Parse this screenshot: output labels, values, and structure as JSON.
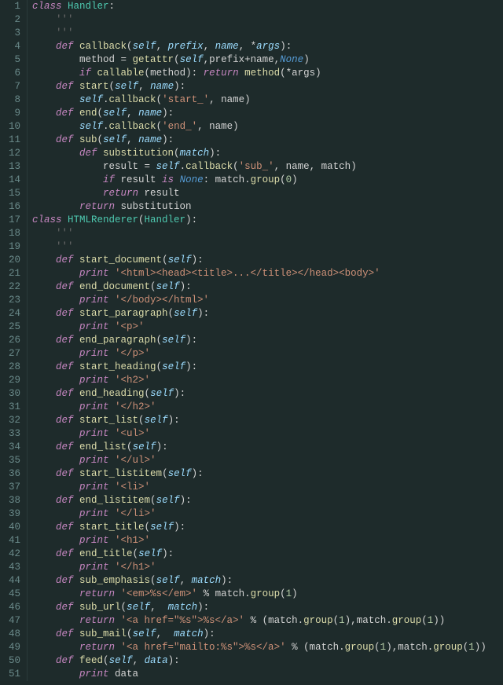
{
  "file_type": "python",
  "line_count": 51,
  "lines": {
    "l1": {
      "indent": "",
      "tokens": [
        [
          "kw",
          "class "
        ],
        [
          "cls",
          "Handler"
        ],
        [
          "punct",
          ":"
        ]
      ]
    },
    "l2": {
      "indent": "    ",
      "tokens": [
        [
          "cmt",
          "'''"
        ]
      ]
    },
    "l3": {
      "indent": "    ",
      "tokens": [
        [
          "cmt",
          "'''"
        ]
      ]
    },
    "l4": {
      "indent": "    ",
      "tokens": [
        [
          "kw",
          "def "
        ],
        [
          "fn",
          "callback"
        ],
        [
          "punct",
          "("
        ],
        [
          "self",
          "self"
        ],
        [
          "punct",
          ", "
        ],
        [
          "param",
          "prefix"
        ],
        [
          "punct",
          ", "
        ],
        [
          "param",
          "name"
        ],
        [
          "punct",
          ", "
        ],
        [
          "op",
          "*"
        ],
        [
          "param",
          "args"
        ],
        [
          "punct",
          "):"
        ]
      ]
    },
    "l5": {
      "indent": "        ",
      "tokens": [
        [
          "op",
          "method "
        ],
        [
          "op",
          "= "
        ],
        [
          "getattr",
          "getattr"
        ],
        [
          "punct",
          "("
        ],
        [
          "self",
          "self"
        ],
        [
          "punct",
          ","
        ],
        [
          "op",
          "prefix"
        ],
        [
          "op",
          "+"
        ],
        [
          "op",
          "name"
        ],
        [
          "punct",
          ","
        ],
        [
          "none",
          "None"
        ],
        [
          "punct",
          ")"
        ]
      ]
    },
    "l6": {
      "indent": "        ",
      "tokens": [
        [
          "kw",
          "if "
        ],
        [
          "builtin",
          "callable"
        ],
        [
          "punct",
          "("
        ],
        [
          "op",
          "method"
        ],
        [
          "punct",
          "): "
        ],
        [
          "kw",
          "return "
        ],
        [
          "fn",
          "method"
        ],
        [
          "punct",
          "("
        ],
        [
          "op",
          "*"
        ],
        [
          "op",
          "args"
        ],
        [
          "punct",
          ")"
        ]
      ]
    },
    "l7": {
      "indent": "    ",
      "tokens": [
        [
          "kw",
          "def "
        ],
        [
          "fn",
          "start"
        ],
        [
          "punct",
          "("
        ],
        [
          "self",
          "self"
        ],
        [
          "punct",
          ", "
        ],
        [
          "param",
          "name"
        ],
        [
          "punct",
          "):"
        ]
      ]
    },
    "l8": {
      "indent": "        ",
      "tokens": [
        [
          "self",
          "self"
        ],
        [
          "punct",
          "."
        ],
        [
          "fn",
          "callback"
        ],
        [
          "punct",
          "("
        ],
        [
          "str",
          "'start_'"
        ],
        [
          "punct",
          ", "
        ],
        [
          "op",
          "name"
        ],
        [
          "punct",
          ")"
        ]
      ]
    },
    "l9": {
      "indent": "    ",
      "tokens": [
        [
          "kw",
          "def "
        ],
        [
          "fn",
          "end"
        ],
        [
          "punct",
          "("
        ],
        [
          "self",
          "self"
        ],
        [
          "punct",
          ", "
        ],
        [
          "param",
          "name"
        ],
        [
          "punct",
          "):"
        ]
      ]
    },
    "l10": {
      "indent": "        ",
      "tokens": [
        [
          "self",
          "self"
        ],
        [
          "punct",
          "."
        ],
        [
          "fn",
          "callback"
        ],
        [
          "punct",
          "("
        ],
        [
          "str",
          "'end_'"
        ],
        [
          "punct",
          ", "
        ],
        [
          "op",
          "name"
        ],
        [
          "punct",
          ")"
        ]
      ]
    },
    "l11": {
      "indent": "    ",
      "tokens": [
        [
          "kw",
          "def "
        ],
        [
          "fn",
          "sub"
        ],
        [
          "punct",
          "("
        ],
        [
          "self",
          "self"
        ],
        [
          "punct",
          ", "
        ],
        [
          "param",
          "name"
        ],
        [
          "punct",
          "):"
        ]
      ]
    },
    "l12": {
      "indent": "        ",
      "tokens": [
        [
          "kw",
          "def "
        ],
        [
          "fn",
          "substitution"
        ],
        [
          "punct",
          "("
        ],
        [
          "param",
          "match"
        ],
        [
          "punct",
          "):"
        ]
      ]
    },
    "l13": {
      "indent": "            ",
      "tokens": [
        [
          "op",
          "result "
        ],
        [
          "op",
          "= "
        ],
        [
          "self",
          "self"
        ],
        [
          "punct",
          "."
        ],
        [
          "fn",
          "callback"
        ],
        [
          "punct",
          "("
        ],
        [
          "str",
          "'sub_'"
        ],
        [
          "punct",
          ", "
        ],
        [
          "op",
          "name"
        ],
        [
          "punct",
          ", "
        ],
        [
          "op",
          "match"
        ],
        [
          "punct",
          ")"
        ]
      ]
    },
    "l14": {
      "indent": "            ",
      "tokens": [
        [
          "kw",
          "if "
        ],
        [
          "op",
          "result "
        ],
        [
          "kw",
          "is "
        ],
        [
          "none",
          "None"
        ],
        [
          "punct",
          ": "
        ],
        [
          "op",
          "match"
        ],
        [
          "punct",
          "."
        ],
        [
          "fn",
          "group"
        ],
        [
          "punct",
          "("
        ],
        [
          "num",
          "0"
        ],
        [
          "punct",
          ")"
        ]
      ]
    },
    "l15": {
      "indent": "            ",
      "tokens": [
        [
          "kw",
          "return "
        ],
        [
          "op",
          "result"
        ]
      ]
    },
    "l16": {
      "indent": "        ",
      "tokens": [
        [
          "kw",
          "return "
        ],
        [
          "op",
          "substitution"
        ]
      ]
    },
    "l17": {
      "indent": "",
      "tokens": [
        [
          "kw",
          "class "
        ],
        [
          "cls",
          "HTMLRenderer"
        ],
        [
          "punct",
          "("
        ],
        [
          "cls",
          "Handler"
        ],
        [
          "punct",
          "):"
        ]
      ]
    },
    "l18": {
      "indent": "    ",
      "tokens": [
        [
          "cmt",
          "'''"
        ]
      ]
    },
    "l19": {
      "indent": "    ",
      "tokens": [
        [
          "cmt",
          "'''"
        ]
      ]
    },
    "l20": {
      "indent": "    ",
      "tokens": [
        [
          "kw",
          "def "
        ],
        [
          "fn",
          "start_document"
        ],
        [
          "punct",
          "("
        ],
        [
          "self",
          "self"
        ],
        [
          "punct",
          "):"
        ]
      ]
    },
    "l21": {
      "indent": "        ",
      "tokens": [
        [
          "kw",
          "print "
        ],
        [
          "str",
          "'<html><head><title>...</title></head><body>'"
        ]
      ]
    },
    "l22": {
      "indent": "    ",
      "tokens": [
        [
          "kw",
          "def "
        ],
        [
          "fn",
          "end_document"
        ],
        [
          "punct",
          "("
        ],
        [
          "self",
          "self"
        ],
        [
          "punct",
          "):"
        ]
      ]
    },
    "l23": {
      "indent": "        ",
      "tokens": [
        [
          "kw",
          "print "
        ],
        [
          "str",
          "'</body></html>'"
        ]
      ]
    },
    "l24": {
      "indent": "    ",
      "tokens": [
        [
          "kw",
          "def "
        ],
        [
          "fn",
          "start_paragraph"
        ],
        [
          "punct",
          "("
        ],
        [
          "self",
          "self"
        ],
        [
          "punct",
          "):"
        ]
      ]
    },
    "l25": {
      "indent": "        ",
      "tokens": [
        [
          "kw",
          "print "
        ],
        [
          "str",
          "'<p>'"
        ]
      ]
    },
    "l26": {
      "indent": "    ",
      "tokens": [
        [
          "kw",
          "def "
        ],
        [
          "fn",
          "end_paragraph"
        ],
        [
          "punct",
          "("
        ],
        [
          "self",
          "self"
        ],
        [
          "punct",
          "):"
        ]
      ]
    },
    "l27": {
      "indent": "        ",
      "tokens": [
        [
          "kw",
          "print "
        ],
        [
          "str",
          "'</p>'"
        ]
      ]
    },
    "l28": {
      "indent": "    ",
      "tokens": [
        [
          "kw",
          "def "
        ],
        [
          "fn",
          "start_heading"
        ],
        [
          "punct",
          "("
        ],
        [
          "self",
          "self"
        ],
        [
          "punct",
          "):"
        ]
      ]
    },
    "l29": {
      "indent": "        ",
      "tokens": [
        [
          "kw",
          "print "
        ],
        [
          "str",
          "'<h2>'"
        ]
      ]
    },
    "l30": {
      "indent": "    ",
      "tokens": [
        [
          "kw",
          "def "
        ],
        [
          "fn",
          "end_heading"
        ],
        [
          "punct",
          "("
        ],
        [
          "self",
          "self"
        ],
        [
          "punct",
          "):"
        ]
      ]
    },
    "l31": {
      "indent": "        ",
      "tokens": [
        [
          "kw",
          "print "
        ],
        [
          "str",
          "'</h2>'"
        ]
      ]
    },
    "l32": {
      "indent": "    ",
      "tokens": [
        [
          "kw",
          "def "
        ],
        [
          "fn",
          "start_list"
        ],
        [
          "punct",
          "("
        ],
        [
          "self",
          "self"
        ],
        [
          "punct",
          "):"
        ]
      ]
    },
    "l33": {
      "indent": "        ",
      "tokens": [
        [
          "kw",
          "print "
        ],
        [
          "str",
          "'<ul>'"
        ]
      ]
    },
    "l34": {
      "indent": "    ",
      "tokens": [
        [
          "kw",
          "def "
        ],
        [
          "fn",
          "end_list"
        ],
        [
          "punct",
          "("
        ],
        [
          "self",
          "self"
        ],
        [
          "punct",
          "):"
        ]
      ]
    },
    "l35": {
      "indent": "        ",
      "tokens": [
        [
          "kw",
          "print "
        ],
        [
          "str",
          "'</ul>'"
        ]
      ]
    },
    "l36": {
      "indent": "    ",
      "tokens": [
        [
          "kw",
          "def "
        ],
        [
          "fn",
          "start_listitem"
        ],
        [
          "punct",
          "("
        ],
        [
          "self",
          "self"
        ],
        [
          "punct",
          "):"
        ]
      ]
    },
    "l37": {
      "indent": "        ",
      "tokens": [
        [
          "kw",
          "print "
        ],
        [
          "str",
          "'<li>'"
        ]
      ]
    },
    "l38": {
      "indent": "    ",
      "tokens": [
        [
          "kw",
          "def "
        ],
        [
          "fn",
          "end_listitem"
        ],
        [
          "punct",
          "("
        ],
        [
          "self",
          "self"
        ],
        [
          "punct",
          "):"
        ]
      ]
    },
    "l39": {
      "indent": "        ",
      "tokens": [
        [
          "kw",
          "print "
        ],
        [
          "str",
          "'</li>'"
        ]
      ]
    },
    "l40": {
      "indent": "    ",
      "tokens": [
        [
          "kw",
          "def "
        ],
        [
          "fn",
          "start_title"
        ],
        [
          "punct",
          "("
        ],
        [
          "self",
          "self"
        ],
        [
          "punct",
          "):"
        ]
      ]
    },
    "l41": {
      "indent": "        ",
      "tokens": [
        [
          "kw",
          "print "
        ],
        [
          "str",
          "'<h1>'"
        ]
      ]
    },
    "l42": {
      "indent": "    ",
      "tokens": [
        [
          "kw",
          "def "
        ],
        [
          "fn",
          "end_title"
        ],
        [
          "punct",
          "("
        ],
        [
          "self",
          "self"
        ],
        [
          "punct",
          "):"
        ]
      ]
    },
    "l43": {
      "indent": "        ",
      "tokens": [
        [
          "kw",
          "print "
        ],
        [
          "str",
          "'</h1>'"
        ]
      ]
    },
    "l44": {
      "indent": "    ",
      "tokens": [
        [
          "kw",
          "def "
        ],
        [
          "fn",
          "sub_emphasis"
        ],
        [
          "punct",
          "("
        ],
        [
          "self",
          "self"
        ],
        [
          "punct",
          ", "
        ],
        [
          "param",
          "match"
        ],
        [
          "punct",
          "):"
        ]
      ]
    },
    "l45": {
      "indent": "        ",
      "tokens": [
        [
          "kw",
          "return "
        ],
        [
          "str",
          "'<em>%s</em>'"
        ],
        [
          "op",
          " % "
        ],
        [
          "op",
          "match"
        ],
        [
          "punct",
          "."
        ],
        [
          "fn",
          "group"
        ],
        [
          "punct",
          "("
        ],
        [
          "num",
          "1"
        ],
        [
          "punct",
          ")"
        ]
      ]
    },
    "l46": {
      "indent": "    ",
      "tokens": [
        [
          "kw",
          "def "
        ],
        [
          "fn",
          "sub_url"
        ],
        [
          "punct",
          "("
        ],
        [
          "self",
          "self"
        ],
        [
          "punct",
          ",  "
        ],
        [
          "param",
          "match"
        ],
        [
          "punct",
          "):"
        ]
      ]
    },
    "l47": {
      "indent": "        ",
      "tokens": [
        [
          "kw",
          "return "
        ],
        [
          "str",
          "'<a href=\"%s\">%s</a>'"
        ],
        [
          "op",
          " % "
        ],
        [
          "punct",
          "("
        ],
        [
          "op",
          "match"
        ],
        [
          "punct",
          "."
        ],
        [
          "fn",
          "group"
        ],
        [
          "punct",
          "("
        ],
        [
          "num",
          "1"
        ],
        [
          "punct",
          "),"
        ],
        [
          "op",
          "match"
        ],
        [
          "punct",
          "."
        ],
        [
          "fn",
          "group"
        ],
        [
          "punct",
          "("
        ],
        [
          "num",
          "1"
        ],
        [
          "punct",
          "))"
        ]
      ]
    },
    "l48": {
      "indent": "    ",
      "tokens": [
        [
          "kw",
          "def "
        ],
        [
          "fn",
          "sub_mail"
        ],
        [
          "punct",
          "("
        ],
        [
          "self",
          "self"
        ],
        [
          "punct",
          ",  "
        ],
        [
          "param",
          "match"
        ],
        [
          "punct",
          "):"
        ]
      ]
    },
    "l49": {
      "indent": "        ",
      "tokens": [
        [
          "kw",
          "return "
        ],
        [
          "str",
          "'<a href=\"mailto:%s\">%s</a>'"
        ],
        [
          "op",
          " % "
        ],
        [
          "punct",
          "("
        ],
        [
          "op",
          "match"
        ],
        [
          "punct",
          "."
        ],
        [
          "fn",
          "group"
        ],
        [
          "punct",
          "("
        ],
        [
          "num",
          "1"
        ],
        [
          "punct",
          "),"
        ],
        [
          "op",
          "match"
        ],
        [
          "punct",
          "."
        ],
        [
          "fn",
          "group"
        ],
        [
          "punct",
          "("
        ],
        [
          "num",
          "1"
        ],
        [
          "punct",
          "))"
        ]
      ]
    },
    "l50": {
      "indent": "    ",
      "tokens": [
        [
          "kw",
          "def "
        ],
        [
          "fn",
          "feed"
        ],
        [
          "punct",
          "("
        ],
        [
          "self",
          "self"
        ],
        [
          "punct",
          ", "
        ],
        [
          "param",
          "data"
        ],
        [
          "punct",
          "):"
        ]
      ]
    },
    "l51": {
      "indent": "        ",
      "tokens": [
        [
          "kw",
          "print "
        ],
        [
          "op",
          "data"
        ]
      ]
    }
  }
}
